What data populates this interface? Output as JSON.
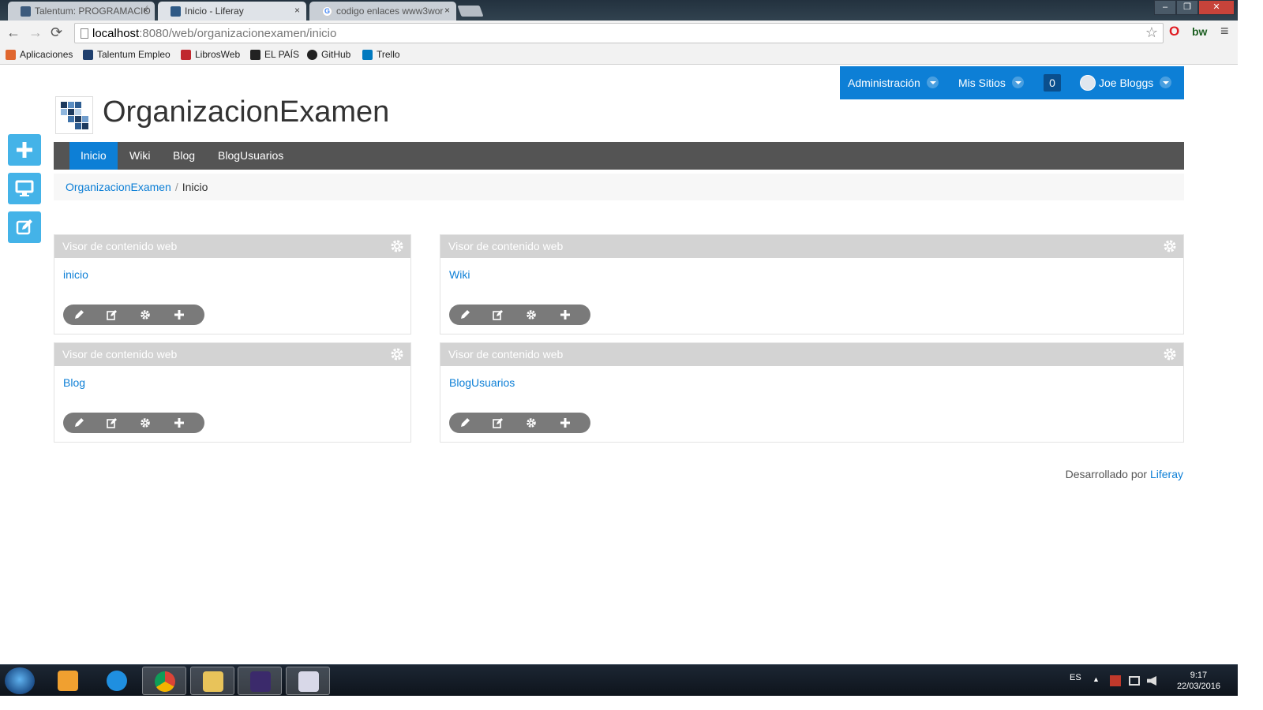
{
  "browser": {
    "tabs": [
      {
        "title": "Talentum: PROGRAMACIÓ",
        "active": false
      },
      {
        "title": "Inicio - Liferay",
        "active": true
      },
      {
        "title": "codigo enlaces www3wor",
        "active": false
      }
    ],
    "tab_close": "×",
    "window_buttons": {
      "minimize": "–",
      "restore": "❐",
      "close": "✕"
    },
    "url_host": "localhost",
    "url_rest": ":8080/web/organizacionexamen/inicio",
    "star_icon": "☆",
    "back_icon": "←",
    "forward_icon": "→",
    "reload_icon": "⟳",
    "menu_icon": "≡",
    "ext_opera": "O",
    "ext_bw": "bw",
    "bookmarks": [
      {
        "label": "Aplicaciones",
        "color": "#e0662e"
      },
      {
        "label": "Talentum Empleo",
        "color": "#1f3f6e"
      },
      {
        "label": "LibrosWeb",
        "color": "#c0282e"
      },
      {
        "label": "EL PAÍS",
        "color": "#222222"
      },
      {
        "label": "GitHub",
        "color": "#222222"
      },
      {
        "label": "Trello",
        "color": "#0079bf"
      }
    ]
  },
  "dockbar": {
    "admin": "Administración",
    "sites": "Mis Sitios",
    "notifications": "0",
    "user": "Joe Bloggs"
  },
  "site": {
    "title": "OrganizacionExamen",
    "nav": [
      "Inicio",
      "Wiki",
      "Blog",
      "BlogUsuarios"
    ],
    "breadcrumb": {
      "parent": "OrganizacionExamen",
      "separator": "/",
      "current": "Inicio"
    }
  },
  "portlets": [
    {
      "title": "Visor de contenido web",
      "link": "inicio"
    },
    {
      "title": "Visor de contenido web",
      "link": "Wiki"
    },
    {
      "title": "Visor de contenido web",
      "link": "Blog"
    },
    {
      "title": "Visor de contenido web",
      "link": "BlogUsuarios"
    }
  ],
  "footer": {
    "text": "Desarrollado por",
    "link": "Liferay"
  },
  "taskbar": {
    "language": "ES",
    "time": "9:17",
    "date": "22/03/2016",
    "tray_arrow": "▲"
  },
  "colors": {
    "accent": "#0d7fd6",
    "navbar": "#545454",
    "side_buttons": "#44b3e8",
    "portlet_header": "#d3d3d3"
  }
}
